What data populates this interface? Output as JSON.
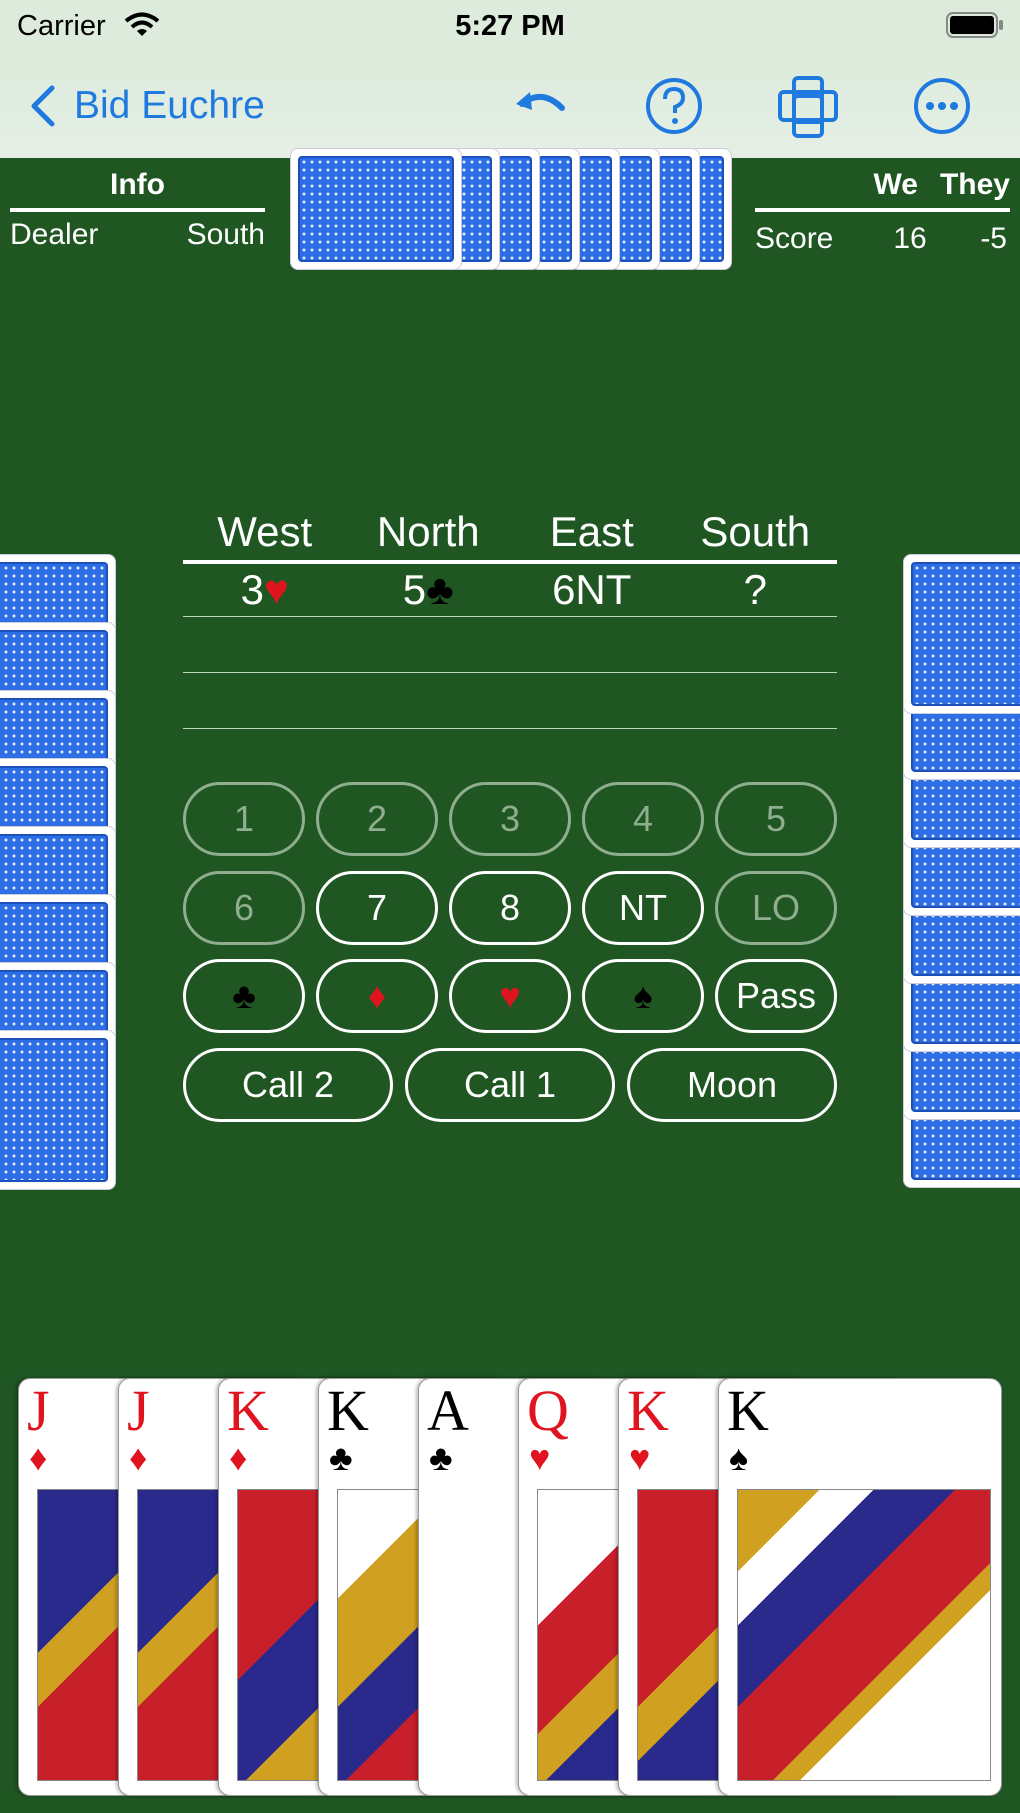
{
  "status": {
    "carrier": "Carrier",
    "time": "5:27 PM"
  },
  "nav": {
    "back_label": "Bid Euchre"
  },
  "info": {
    "header": "Info",
    "dealer_label": "Dealer",
    "dealer_value": "South"
  },
  "score": {
    "we_label": "We",
    "they_label": "They",
    "row_label": "Score",
    "we": "16",
    "they": "-5"
  },
  "bidding": {
    "headers": [
      "West",
      "North",
      "East",
      "South"
    ],
    "row1": {
      "west_num": "3",
      "west_suit": "♥",
      "north_num": "5",
      "north_suit": "♣",
      "east": "6NT",
      "south": "?"
    }
  },
  "buttons": {
    "n1": "1",
    "n2": "2",
    "n3": "3",
    "n4": "4",
    "n5": "5",
    "n6": "6",
    "n7": "7",
    "n8": "8",
    "nt": "NT",
    "lo": "LO",
    "clubs": "♣",
    "diamonds": "♦",
    "hearts": "♥",
    "spades": "♠",
    "pass": "Pass",
    "call2": "Call 2",
    "call1": "Call 1",
    "moon": "Moon"
  },
  "hand": [
    {
      "rank": "J",
      "suit": "♦",
      "color": "#e0141e"
    },
    {
      "rank": "J",
      "suit": "♦",
      "color": "#e0141e"
    },
    {
      "rank": "K",
      "suit": "♦",
      "color": "#e0141e"
    },
    {
      "rank": "K",
      "suit": "♣",
      "color": "#000000"
    },
    {
      "rank": "A",
      "suit": "♣",
      "color": "#000000"
    },
    {
      "rank": "Q",
      "suit": "♥",
      "color": "#e0141e"
    },
    {
      "rank": "K",
      "suit": "♥",
      "color": "#e0141e"
    },
    {
      "rank": "K",
      "suit": "♠",
      "color": "#000000"
    }
  ],
  "colors": {
    "felt": "#1f5622",
    "accent": "#1f7ae0",
    "card_back": "#2d6ee6"
  }
}
